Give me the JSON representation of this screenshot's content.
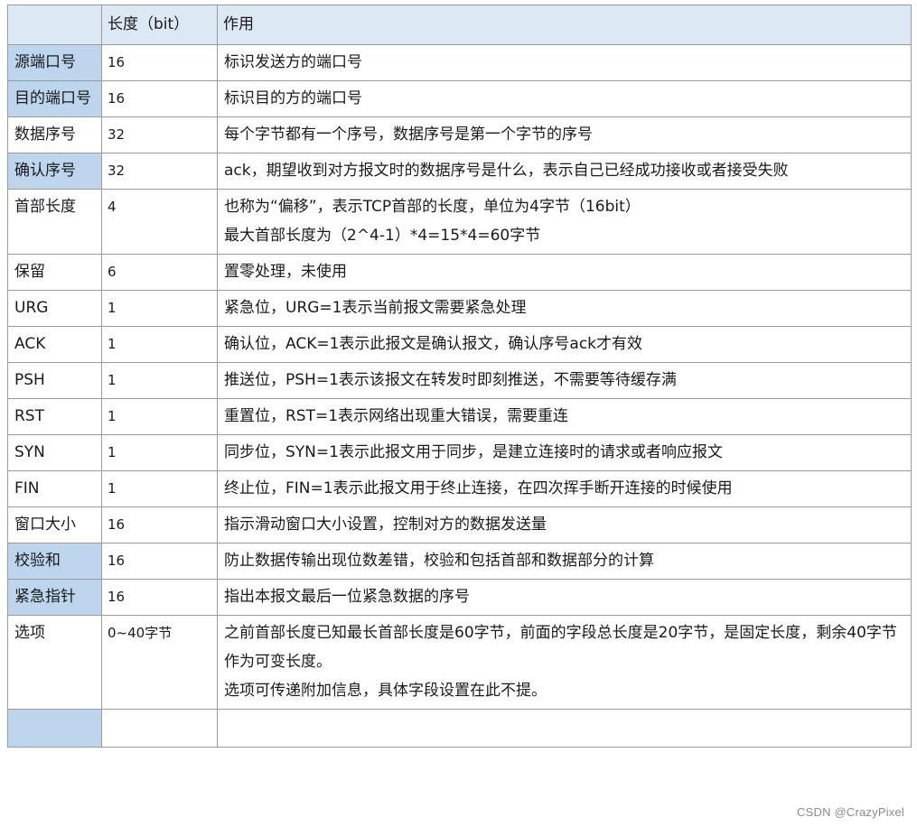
{
  "table": {
    "headers": [
      "",
      "长度（bit）",
      "作用"
    ],
    "rows": [
      {
        "field": "源端口号",
        "highlight": true,
        "length": "16",
        "desc": [
          "标识发送方的端口号"
        ]
      },
      {
        "field": "目的端口号",
        "highlight": true,
        "length": "16",
        "desc": [
          "标识目的方的端口号"
        ]
      },
      {
        "field": "数据序号",
        "highlight": false,
        "length": "32",
        "desc": [
          "每个字节都有一个序号，数据序号是第一个字节的序号"
        ]
      },
      {
        "field": "确认序号",
        "highlight": true,
        "length": "32",
        "desc": [
          "ack，期望收到对方报文时的数据序号是什么，表示自己已经成功接收或者接受失败"
        ]
      },
      {
        "field": "首部长度",
        "highlight": false,
        "length": "4",
        "desc": [
          "也称为“偏移”，表示TCP首部的长度，单位为4字节（16bit）",
          "最大首部长度为（2^4-1）*4=15*4=60字节"
        ]
      },
      {
        "field": "保留",
        "highlight": false,
        "length": "6",
        "desc": [
          "置零处理，未使用"
        ]
      },
      {
        "field": "URG",
        "highlight": false,
        "length": "1",
        "desc": [
          "紧急位，URG=1表示当前报文需要紧急处理"
        ]
      },
      {
        "field": "ACK",
        "highlight": false,
        "length": "1",
        "desc": [
          "确认位，ACK=1表示此报文是确认报文，确认序号ack才有效"
        ]
      },
      {
        "field": "PSH",
        "highlight": false,
        "length": "1",
        "desc": [
          "推送位，PSH=1表示该报文在转发时即刻推送，不需要等待缓存满"
        ]
      },
      {
        "field": "RST",
        "highlight": false,
        "length": "1",
        "desc": [
          "重置位，RST=1表示网络出现重大错误，需要重连"
        ]
      },
      {
        "field": "SYN",
        "highlight": false,
        "length": "1",
        "desc": [
          "同步位，SYN=1表示此报文用于同步，是建立连接时的请求或者响应报文"
        ]
      },
      {
        "field": "FIN",
        "highlight": false,
        "length": "1",
        "desc": [
          "终止位，FIN=1表示此报文用于终止连接，在四次挥手断开连接的时候使用"
        ]
      },
      {
        "field": "窗口大小",
        "highlight": false,
        "length": "16",
        "desc": [
          "指示滑动窗口大小设置，控制对方的数据发送量"
        ]
      },
      {
        "field": "校验和",
        "highlight": true,
        "length": "16",
        "desc": [
          "防止数据传输出现位数差错，校验和包括首部和数据部分的计算"
        ]
      },
      {
        "field": "紧急指针",
        "highlight": true,
        "length": "16",
        "desc": [
          "指出本报文最后一位紧急数据的序号"
        ]
      },
      {
        "field": "选项",
        "highlight": false,
        "length": "0~40字节",
        "desc": [
          "之前首部长度已知最长首部长度是60字节，前面的字段总长度是20字节，是固定长度，剩余40字节作为可变长度。",
          "选项可传递附加信息，具体字段设置在此不提。"
        ]
      },
      {
        "field": "",
        "highlight": true,
        "length": "",
        "desc": [
          ""
        ]
      }
    ]
  },
  "watermark": "CSDN @CrazyPixel"
}
